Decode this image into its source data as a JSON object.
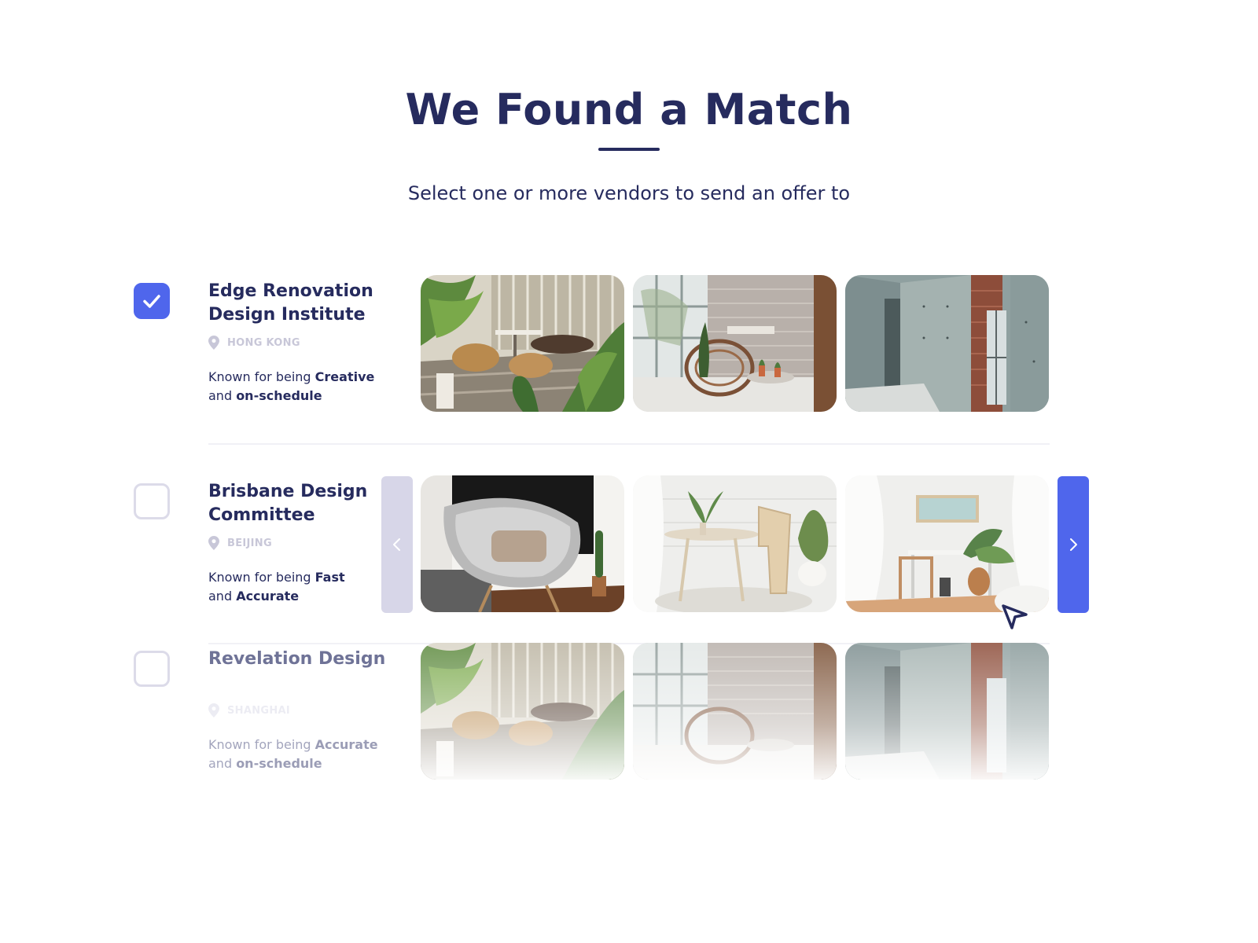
{
  "header": {
    "title": "We Found a Match",
    "subtitle": "Select one or more vendors to send an offer to"
  },
  "colors": {
    "primary": "#262b5e",
    "accent": "#4f66ec",
    "muted": "#c8c7d8"
  },
  "vendors": [
    {
      "name": "Edge Renovation Design Institute",
      "location": "HONG KONG",
      "desc_prefix": "Known for being ",
      "trait1": "Creative",
      "desc_mid": "and ",
      "trait2": "on-schedule",
      "selected": true,
      "photos": [
        "patio-with-plants-photo",
        "brick-wall-chair-photo",
        "concrete-wall-photo"
      ]
    },
    {
      "name": "Brisbane Design Committee",
      "location": "BEIJING",
      "desc_prefix": "Known for being ",
      "trait1": "Fast",
      "desc_mid": "and ",
      "trait2": "Accurate",
      "selected": false,
      "photos": [
        "grey-lounge-chair-photo",
        "white-dining-table-photo",
        "white-desk-room-photo"
      ]
    },
    {
      "name": "Revelation Design",
      "location": "SHANGHAI",
      "desc_prefix": "Known for being ",
      "trait1": "Accurate",
      "desc_mid": "and ",
      "trait2": "on-schedule",
      "selected": false,
      "photos": [
        "patio-with-plants-photo",
        "brick-wall-chair-photo",
        "concrete-wall-photo"
      ]
    }
  ],
  "icons": {
    "check": "check-icon",
    "location": "location-pin-icon",
    "prev": "chevron-left-icon",
    "next": "chevron-right-icon",
    "cursor": "cursor-arrow-icon"
  }
}
